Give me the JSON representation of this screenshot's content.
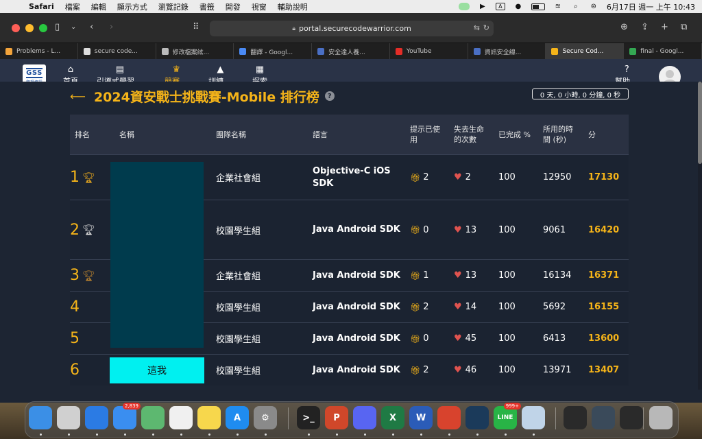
{
  "menubar": {
    "app": "Safari",
    "items": [
      "檔案",
      "編輯",
      "顯示方式",
      "瀏覽記錄",
      "書籤",
      "開發",
      "視窗",
      "輔助說明"
    ],
    "input_indicator": "A",
    "datetime": "6月17日 週一 上午 10:43"
  },
  "browser": {
    "url": "portal.securecodewarrior.com",
    "tabs": [
      {
        "label": "Problems - L...",
        "color": "#f3a43b"
      },
      {
        "label": "secure code...",
        "color": "#dddddd"
      },
      {
        "label": "修改檔案絃...",
        "color": "#bbbbbb"
      },
      {
        "label": "翻譯 - Googl...",
        "color": "#4a8af4"
      },
      {
        "label": "安全達人養...",
        "color": "#4a6fc4"
      },
      {
        "label": "YouTube",
        "color": "#e52d27"
      },
      {
        "label": "資訊安全線...",
        "color": "#4a6fc4"
      },
      {
        "label": "Secure Cod...",
        "color": "#f5b419",
        "active": true
      },
      {
        "label": "final - Googl...",
        "color": "#34a853"
      }
    ]
  },
  "sitenav": {
    "logo_text": "GSS",
    "logo_sub": "叡揚資訊",
    "items": [
      {
        "label": "首頁",
        "icon": "home-icon",
        "glyph": "⌂"
      },
      {
        "label": "引導式學習",
        "icon": "clipboard-icon",
        "glyph": "▤",
        "dropdown": true
      },
      {
        "label": "競賽",
        "icon": "trophy-icon",
        "glyph": "🏆",
        "dropdown": true,
        "active": true
      },
      {
        "label": "訓練",
        "icon": "graduation-cap-icon",
        "glyph": "▲",
        "dropdown": true
      },
      {
        "label": "探索",
        "icon": "book-icon",
        "glyph": "▦"
      }
    ],
    "help_label": "幫助"
  },
  "page": {
    "title": "2024資安戰士挑戰賽-Mobile 排行榜",
    "countdown": "0 天, 0 小時, 0 分鐘, 0 秒"
  },
  "table": {
    "headers": {
      "rank": "排名",
      "name": "名稱",
      "team": "團隊名稱",
      "language": "語言",
      "hints": "提示已使用",
      "lives": "失去生命的次數",
      "completed": "已完成 %",
      "time": "所用的時間 (秒)",
      "score": "分"
    },
    "rows": [
      {
        "rank": "1",
        "trophy": "gold",
        "name": "",
        "team": "企業社會組",
        "language": "Objective-C iOS SDK",
        "hints": "2",
        "lives": "2",
        "completed": "100",
        "time": "12950",
        "score": "17130"
      },
      {
        "rank": "2",
        "trophy": "silver",
        "name": "",
        "team": "校園學生組",
        "language": "Java Android SDK",
        "hints": "0",
        "lives": "13",
        "completed": "100",
        "time": "9061",
        "score": "16420"
      },
      {
        "rank": "3",
        "trophy": "bronze",
        "name": "",
        "team": "企業社會組",
        "language": "Java Android SDK",
        "hints": "1",
        "lives": "13",
        "completed": "100",
        "time": "16134",
        "score": "16371"
      },
      {
        "rank": "4",
        "trophy": "",
        "name": "",
        "team": "校園學生組",
        "language": "Java Android SDK",
        "hints": "2",
        "lives": "14",
        "completed": "100",
        "time": "5692",
        "score": "16155"
      },
      {
        "rank": "5",
        "trophy": "",
        "name": "",
        "team": "校園學生組",
        "language": "Java Android SDK",
        "hints": "0",
        "lives": "45",
        "completed": "100",
        "time": "6413",
        "score": "13600"
      },
      {
        "rank": "6",
        "trophy": "",
        "name": "這我",
        "team": "校園學生組",
        "language": "Java Android SDK",
        "hints": "2",
        "lives": "46",
        "completed": "100",
        "time": "13971",
        "score": "13407"
      }
    ]
  },
  "dock": {
    "mail_badge": "2,839",
    "line_badge": "999+"
  }
}
